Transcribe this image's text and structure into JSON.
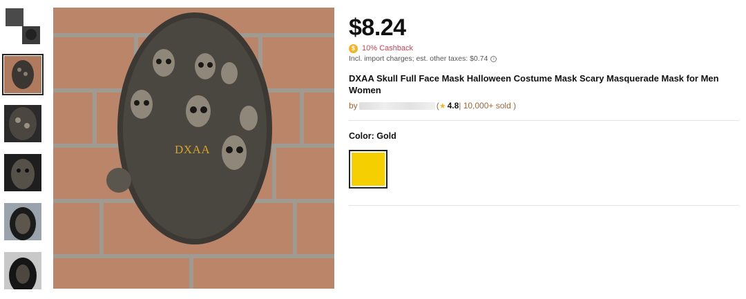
{
  "gallery": {
    "thumbnails": [
      {
        "name": "thumb-1",
        "selected": false
      },
      {
        "name": "thumb-2",
        "selected": true
      },
      {
        "name": "thumb-3",
        "selected": false
      },
      {
        "name": "thumb-4",
        "selected": false
      },
      {
        "name": "thumb-5",
        "selected": false
      },
      {
        "name": "thumb-6",
        "selected": false
      }
    ],
    "main_image_brand": "DXAA"
  },
  "product": {
    "price": "$8.24",
    "cashback_icon": "$",
    "cashback": "10% Cashback",
    "tax_note": "Incl. import charges; est. other taxes: $0.74",
    "title": "DXAA Skull Full Face Mask Halloween Costume Mask Scary Masquerade Mask for Men Women",
    "seller_prefix": "by",
    "rating_open": "(",
    "rating": "4.8",
    "sold": "| 10,000+ sold )",
    "color_label": "Color: Gold",
    "selected_color": "#f5cf00"
  },
  "colors": {
    "cashback": "#e0394b",
    "seller": "#a0663a",
    "star": "#f2b428"
  }
}
